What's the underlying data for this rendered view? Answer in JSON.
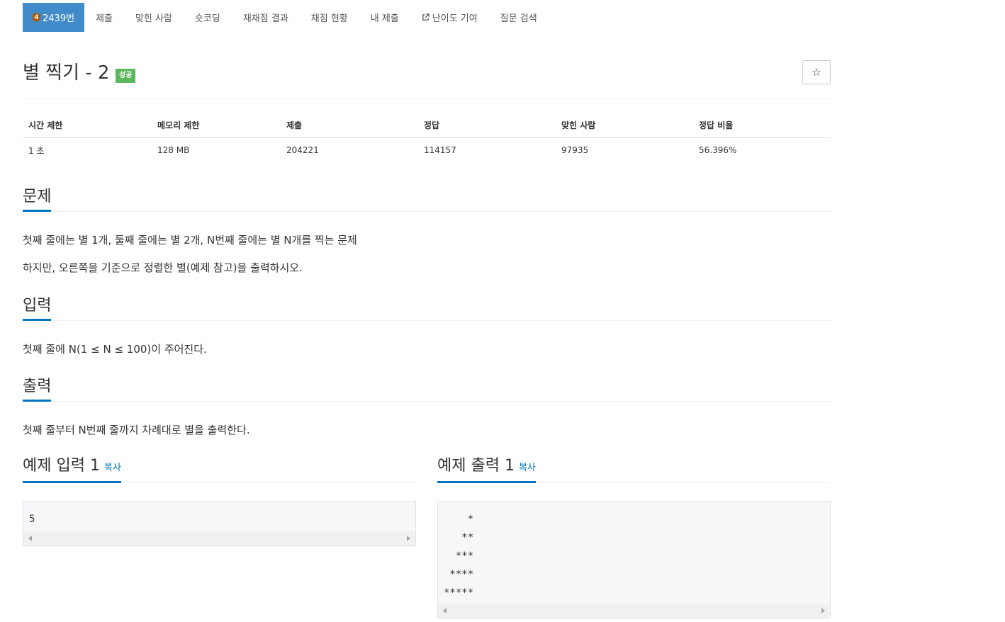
{
  "nav": {
    "tabs": [
      {
        "label": "2439번",
        "active": true,
        "tier": "4"
      },
      {
        "label": "제출"
      },
      {
        "label": "맞힌 사람"
      },
      {
        "label": "숏코딩"
      },
      {
        "label": "재채점 결과"
      },
      {
        "label": "채점 현황"
      },
      {
        "label": "내 제출"
      },
      {
        "label": "난이도 기여",
        "icon": "external-link-icon"
      },
      {
        "label": "질문 검색"
      }
    ]
  },
  "problem": {
    "title": "별 찍기 - 2",
    "status_badge": "성공",
    "star_icon": "☆"
  },
  "info_table": {
    "headers": [
      "시간 제한",
      "메모리 제한",
      "제출",
      "정답",
      "맞힌 사람",
      "정답 비율"
    ],
    "values": [
      "1 초",
      "128 MB",
      "204221",
      "114157",
      "97935",
      "56.396%"
    ]
  },
  "sections": {
    "description": {
      "title": "문제",
      "paragraphs": [
        "첫째 줄에는 별 1개, 둘째 줄에는 별 2개, N번째 줄에는 별 N개를 찍는 문제",
        "하지만, 오른쪽을 기준으로 정렬한 별(예제 참고)을 출력하시오."
      ]
    },
    "input": {
      "title": "입력",
      "text": "첫째 줄에 N(1 ≤ N ≤ 100)이 주어진다."
    },
    "output": {
      "title": "출력",
      "text": "첫째 줄부터 N번째 줄까지 차례대로 별을 출력한다."
    }
  },
  "samples": {
    "input": {
      "title": "예제 입력 1",
      "copy_label": "복사",
      "content": "5"
    },
    "output": {
      "title": "예제 출력 1",
      "copy_label": "복사",
      "content": "    *\n   **\n  ***\n ****\n*****"
    }
  },
  "colors": {
    "active_tab": "#428bca",
    "success": "#5cb85c",
    "link": "#0076c0",
    "tier_bronze": "#ad5600"
  }
}
